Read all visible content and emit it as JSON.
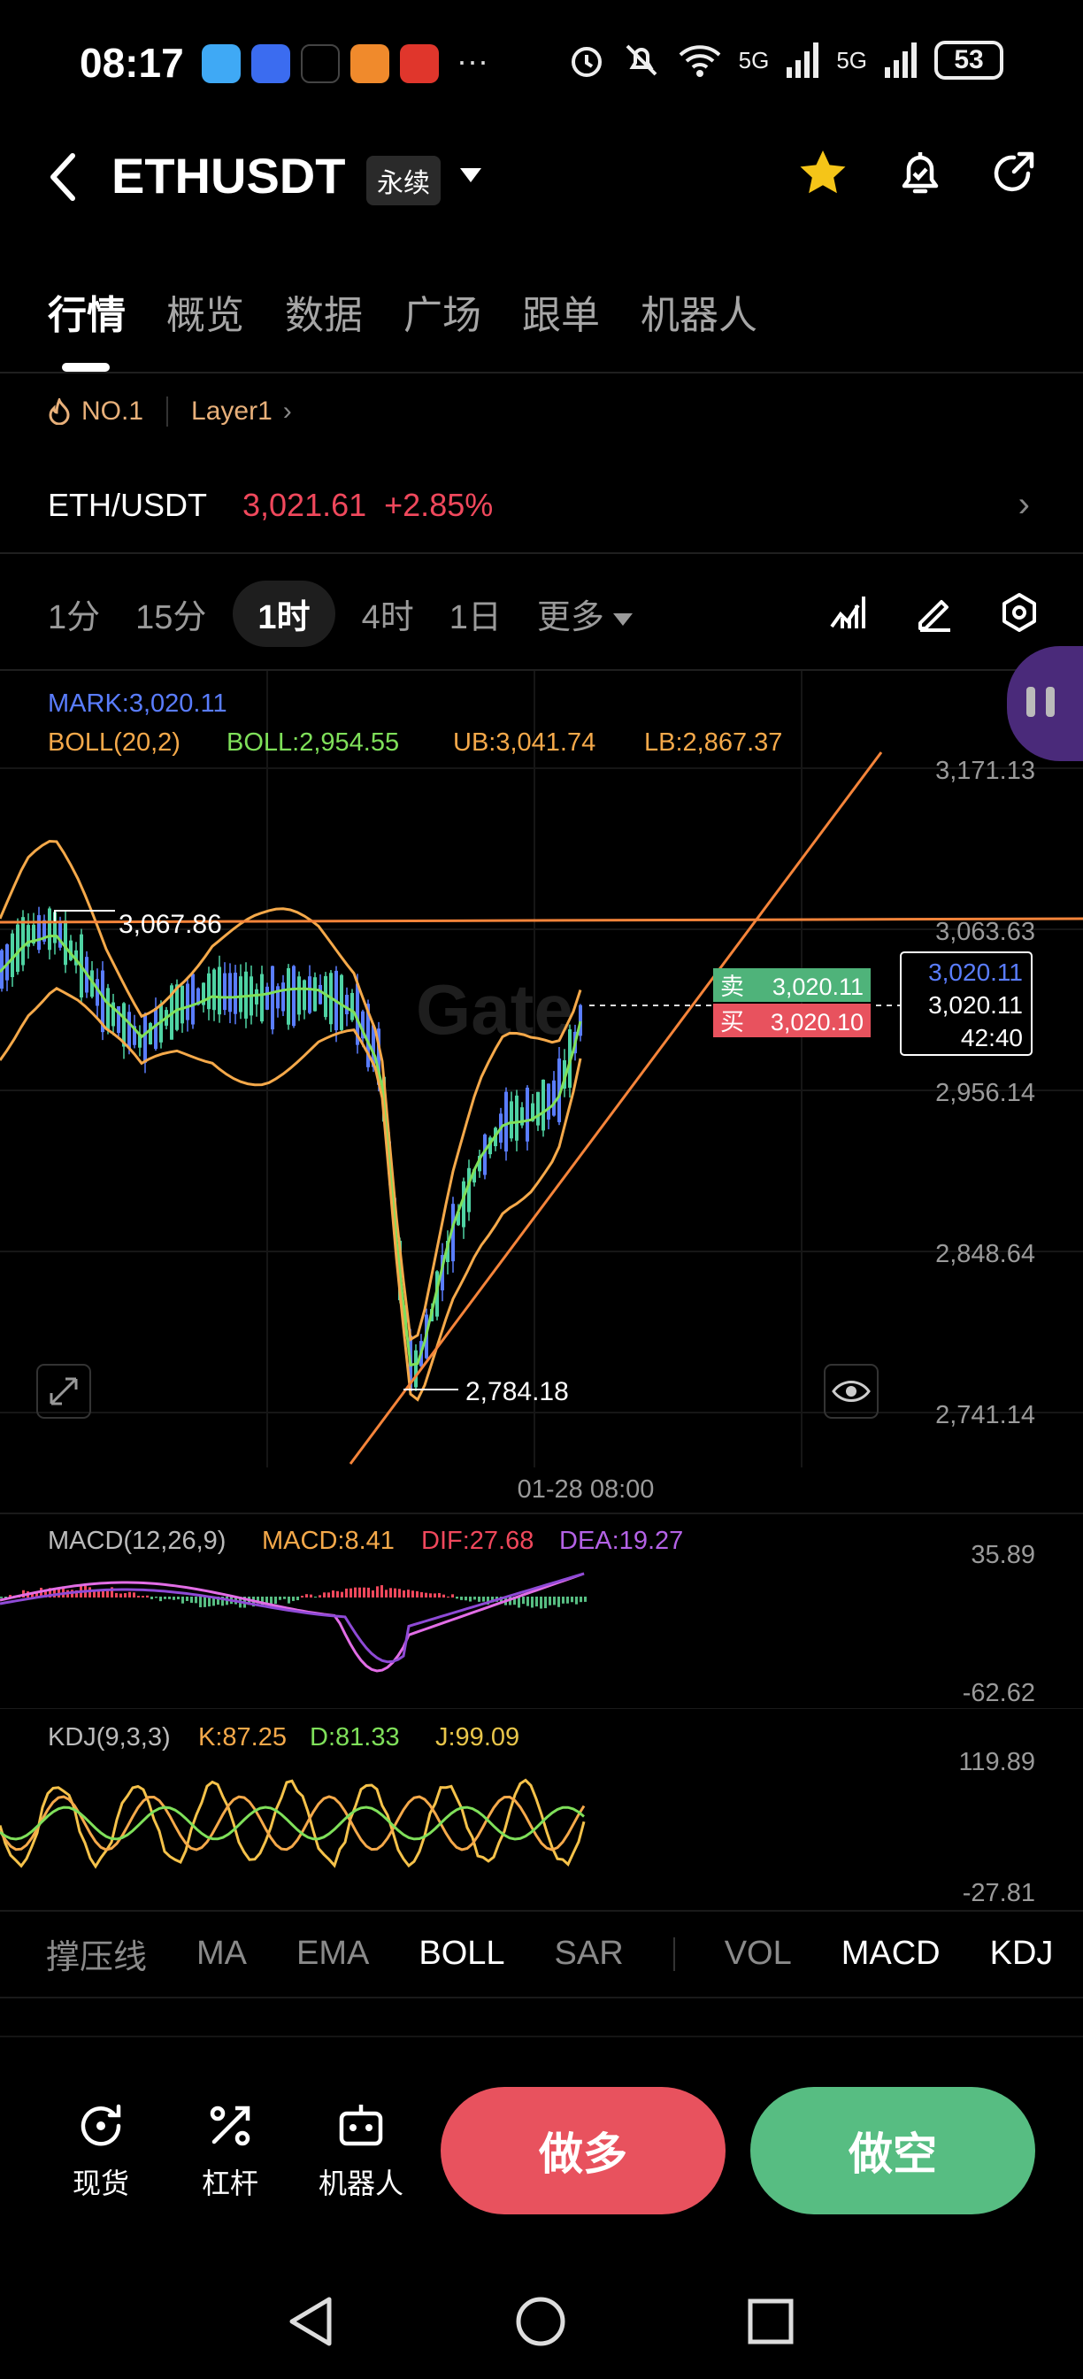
{
  "status_bar": {
    "time": "08:17",
    "dots": "···",
    "network_1": "5G",
    "network_2": "5G",
    "battery": "53",
    "app_icons": [
      "reader-app-icon",
      "app-market-icon",
      "tiktok-icon",
      "shopping-app-icon",
      "game-app-icon"
    ]
  },
  "header": {
    "symbol": "ETHUSDT",
    "contract_type": "永续",
    "icons": [
      "back-icon",
      "star-icon",
      "price-alert-icon",
      "share-icon"
    ],
    "star_color": "#f5c518"
  },
  "tabs": [
    "行情",
    "概览",
    "数据",
    "广场",
    "跟单",
    "机器人"
  ],
  "active_tab": "行情",
  "rank": {
    "badge": "NO.1",
    "category": "Layer1"
  },
  "ticker": {
    "pair": "ETH/USDT",
    "price": "3,021.61",
    "change": "+2.85%",
    "color": "#f0485c"
  },
  "intervals": {
    "items": [
      "1分",
      "15分",
      "1时",
      "4时",
      "1日"
    ],
    "selected": "1时",
    "more": "更多"
  },
  "toolbar_icons": [
    "indicator-icon",
    "draw-icon",
    "settings-icon"
  ],
  "main_chart": {
    "mark": "MARK:3,020.11",
    "boll_label": "BOLL(20,2)",
    "boll_value": "BOLL:2,954.55",
    "ub": "UB:3,041.74",
    "lb": "LB:2,867.37",
    "high_label": "3,067.86",
    "low_label": "2,784.18",
    "price_axis": [
      "3,171.13",
      "3,063.63",
      "2,956.14",
      "2,848.64",
      "2,741.14"
    ],
    "ask_label": "卖",
    "ask_price": "3,020.11",
    "bid_label": "买",
    "bid_price": "3,020.10",
    "box_mark": "3,020.11",
    "box_last": "3,020.11",
    "box_countdown": "42:40",
    "time_label": "01-28 08:00",
    "watermark": "Gate"
  },
  "macd": {
    "label": "MACD(12,26,9)",
    "macd": "MACD:8.41",
    "dif": "DIF:27.68",
    "dea": "DEA:19.27",
    "axis_top": "35.89",
    "axis_bottom": "-62.62"
  },
  "kdj": {
    "label": "KDJ(9,3,3)",
    "k": "K:87.25",
    "d": "D:81.33",
    "j": "J:99.09",
    "axis_top": "119.89",
    "axis_bottom": "-27.81"
  },
  "indicator_tabs": {
    "left": [
      "撑压线",
      "MA",
      "EMA",
      "BOLL",
      "SAR"
    ],
    "right": [
      "VOL",
      "MACD",
      "KDJ"
    ],
    "active": [
      "BOLL",
      "MACD",
      "KDJ"
    ]
  },
  "actions": {
    "spot": "现货",
    "margin": "杠杆",
    "bot": "机器人",
    "long": "做多",
    "short": "做空"
  },
  "colors": {
    "up": "#57bd82",
    "down": "#f0485c",
    "long_button": "#e8525e",
    "short_button": "#57bd82",
    "boll_line": "#f5a94a",
    "boll_mid": "#7fe05a",
    "mark": "#5a7dff"
  }
}
